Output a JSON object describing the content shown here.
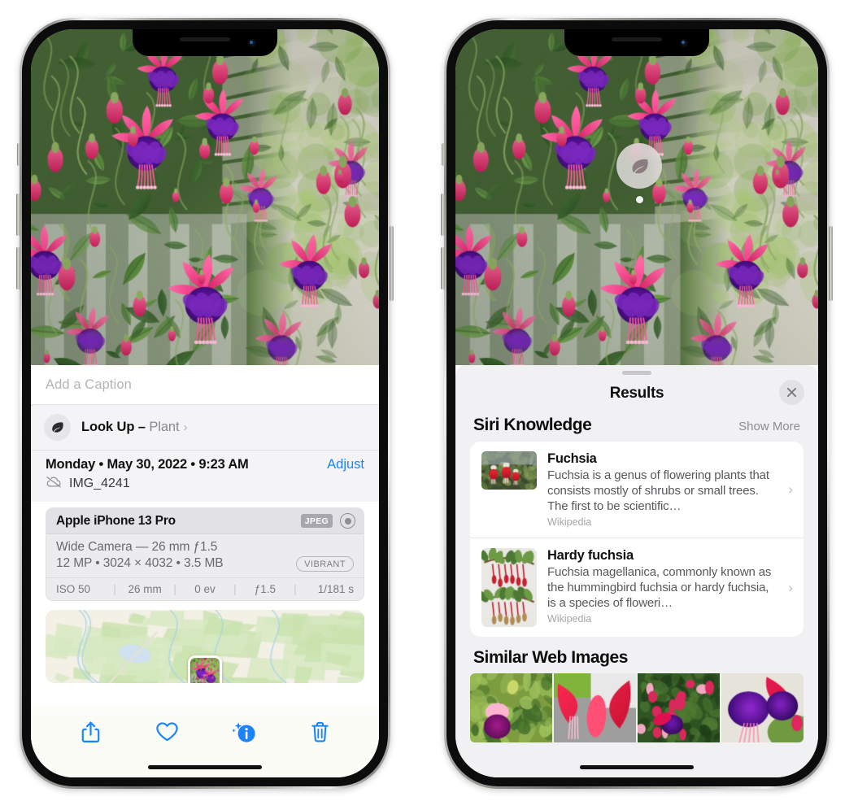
{
  "left_phone": {
    "caption": {
      "placeholder": "Add a Caption",
      "value": ""
    },
    "lookup": {
      "label": "Look Up –",
      "subject": "Plant",
      "chevron": "›",
      "icon": "leaf-icon"
    },
    "metadata": {
      "date": "Monday • May 30, 2022 • 9:23 AM",
      "adjust_label": "Adjust",
      "filename": "IMG_4241",
      "cloud_icon": "icloud-slash-icon"
    },
    "exif": {
      "device": "Apple iPhone 13 Pro",
      "format_chip": "JPEG",
      "raw_icon": "aperture-icon",
      "lens_line": "Wide Camera — 26 mm ƒ1.5",
      "size_line": "12 MP • 3024 × 4032 • 3.5 MB",
      "style_chip": "VIBRANT",
      "stats": [
        "ISO 50",
        "26 mm",
        "0 ev",
        "ƒ1.5",
        "1/181 s"
      ]
    },
    "toolbar": [
      {
        "name": "share-button",
        "icon": "share-icon"
      },
      {
        "name": "favorite-button",
        "icon": "heart-icon"
      },
      {
        "name": "info-button",
        "icon": "info-sparkle-icon"
      },
      {
        "name": "delete-button",
        "icon": "trash-icon"
      }
    ],
    "accent_color": "#1a84ff"
  },
  "right_phone": {
    "visual_lookup_badge": {
      "icon": "leaf-icon"
    },
    "sheet": {
      "title": "Results",
      "close_icon": "close-icon",
      "sections": [
        {
          "title": "Siri Knowledge",
          "action": "Show More",
          "items": [
            {
              "title": "Fuchsia",
              "description": "Fuchsia is a genus of flowering plants that consists mostly of shrubs or small trees. The first to be scientific…",
              "source": "Wikipedia",
              "chevron": "›"
            },
            {
              "title": "Hardy fuchsia",
              "description": "Fuchsia magellanica, commonly known as the hummingbird fuchsia or hardy fuchsia, is a species of floweri…",
              "source": "Wikipedia",
              "chevron": "›"
            }
          ]
        },
        {
          "title": "Similar Web Images",
          "action": "",
          "thumbnails": [
            "web-image-1",
            "web-image-2",
            "web-image-3",
            "web-image-4"
          ]
        }
      ]
    }
  }
}
